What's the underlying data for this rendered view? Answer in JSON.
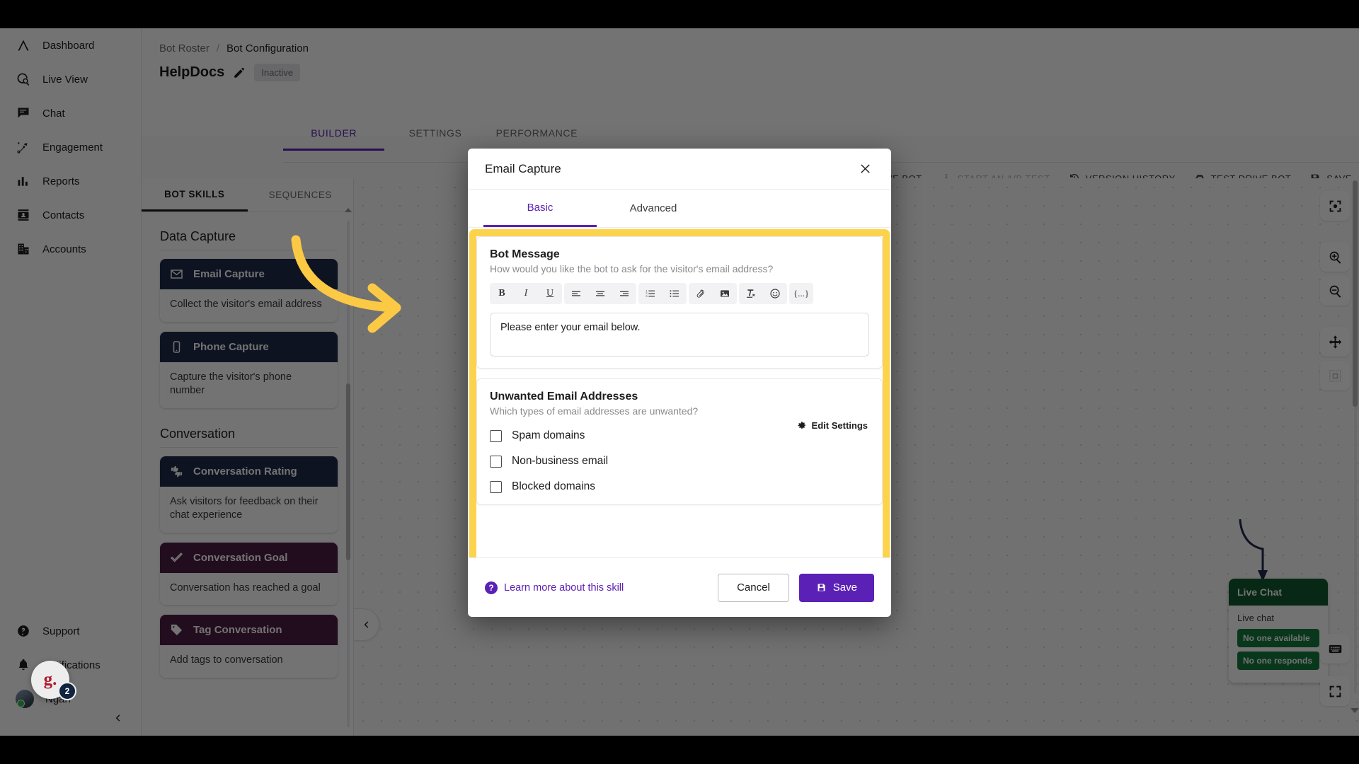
{
  "sidebar": {
    "items": [
      {
        "label": "Dashboard",
        "icon": "logo-a-icon"
      },
      {
        "label": "Live View",
        "icon": "live-view-icon"
      },
      {
        "label": "Chat",
        "icon": "chat-icon"
      },
      {
        "label": "Engagement",
        "icon": "engagement-icon"
      },
      {
        "label": "Reports",
        "icon": "reports-icon"
      },
      {
        "label": "Contacts",
        "icon": "contacts-icon"
      },
      {
        "label": "Accounts",
        "icon": "accounts-icon"
      }
    ],
    "bottom_items": [
      {
        "label": "Support",
        "icon": "help-circle-icon"
      },
      {
        "label": "Notifications",
        "icon": "bell-icon"
      }
    ],
    "user": {
      "name": "Ngan"
    },
    "collapse_icon": "chevron-left-icon"
  },
  "g2_widget": {
    "initial": "g.",
    "count": "2"
  },
  "header": {
    "breadcrumb": {
      "parent": "Bot Roster",
      "separator": "/",
      "current": "Bot Configuration"
    },
    "bot_name": "HelpDocs",
    "status": "Inactive",
    "tabs": [
      {
        "label": "BUILDER",
        "active": true
      },
      {
        "label": "SETTINGS",
        "active": false
      },
      {
        "label": "PERFORMANCE",
        "active": false
      }
    ]
  },
  "toolbar": {
    "buttons": [
      {
        "label": "ARCHIVE BOT",
        "icon": "trash-icon",
        "disabled": false
      },
      {
        "label": "START AN A/B TEST",
        "icon": "flask-icon",
        "disabled": true
      },
      {
        "label": "VERSION HISTORY",
        "icon": "history-icon",
        "disabled": false
      },
      {
        "label": "TEST DRIVE BOT",
        "icon": "car-icon",
        "disabled": false
      },
      {
        "label": "SAVE",
        "icon": "save-icon",
        "disabled": false
      }
    ]
  },
  "skills_panel": {
    "tabs": [
      {
        "label": "BOT SKILLS",
        "active": true
      },
      {
        "label": "SEQUENCES",
        "active": false
      }
    ],
    "groups": [
      {
        "title": "Data Capture",
        "cards": [
          {
            "title": "Email Capture",
            "desc": "Collect the visitor's email address",
            "color": "navy",
            "icon": "envelope-icon"
          },
          {
            "title": "Phone Capture",
            "desc": "Capture the visitor's phone number",
            "color": "navy",
            "icon": "phone-icon"
          }
        ]
      },
      {
        "title": "Conversation",
        "cards": [
          {
            "title": "Conversation Rating",
            "desc": "Ask visitors for feedback on their chat experience",
            "color": "navy",
            "icon": "thumbs-icon"
          },
          {
            "title": "Conversation Goal",
            "desc": "Conversation has reached a goal",
            "color": "plum",
            "icon": "check-icon"
          },
          {
            "title": "Tag Conversation",
            "desc": "Add tags to conversation",
            "color": "plum",
            "icon": "tag-icon"
          }
        ]
      }
    ]
  },
  "canvas": {
    "collapse_icon": "chevron-left-icon",
    "node": {
      "title": "Live Chat",
      "subtitle": "Live chat",
      "options": [
        "No one available",
        "No one responds"
      ]
    },
    "rail_top": [
      {
        "icon": "center-focus-icon"
      },
      {
        "icon": "zoom-in-icon"
      },
      {
        "icon": "zoom-out-icon"
      },
      {
        "icon": "pan-move-icon"
      },
      {
        "icon": "grid-fit-icon"
      }
    ],
    "rail_bottom": [
      {
        "icon": "keyboard-icon"
      },
      {
        "icon": "fullscreen-icon"
      }
    ]
  },
  "modal": {
    "title": "Email Capture",
    "close_icon": "close-icon",
    "tabs": [
      {
        "label": "Basic",
        "active": true
      },
      {
        "label": "Advanced",
        "active": false
      }
    ],
    "bot_message": {
      "title": "Bot Message",
      "subtitle": "How would you like the bot to ask for the visitor's email address?",
      "value": "Please enter your email below.",
      "toolbar": [
        {
          "icon": "bold-icon",
          "glyph": "B"
        },
        {
          "icon": "italic-icon",
          "glyph": "I"
        },
        {
          "icon": "underline-icon",
          "glyph": "U"
        },
        {
          "icon": "align-left-icon"
        },
        {
          "icon": "align-center-icon"
        },
        {
          "icon": "align-right-icon"
        },
        {
          "icon": "ordered-list-icon"
        },
        {
          "icon": "bullet-list-icon"
        },
        {
          "icon": "attachment-icon"
        },
        {
          "icon": "image-icon"
        },
        {
          "icon": "clear-format-icon"
        },
        {
          "icon": "emoji-icon"
        },
        {
          "icon": "variable-icon",
          "glyph": "{...}"
        }
      ]
    },
    "unwanted": {
      "title": "Unwanted Email Addresses",
      "subtitle": "Which types of email addresses are unwanted?",
      "edit_settings_label": "Edit Settings",
      "edit_settings_icon": "gear-icon",
      "options": [
        {
          "label": "Spam domains",
          "checked": false
        },
        {
          "label": "Non-business email",
          "checked": false
        },
        {
          "label": "Blocked domains",
          "checked": false
        }
      ]
    },
    "footer": {
      "learn_more": "Learn more about this skill",
      "cancel": "Cancel",
      "save": "Save"
    }
  },
  "annotation": {
    "arrow_color": "#fbc944",
    "highlight_color": "#fcd34d"
  }
}
